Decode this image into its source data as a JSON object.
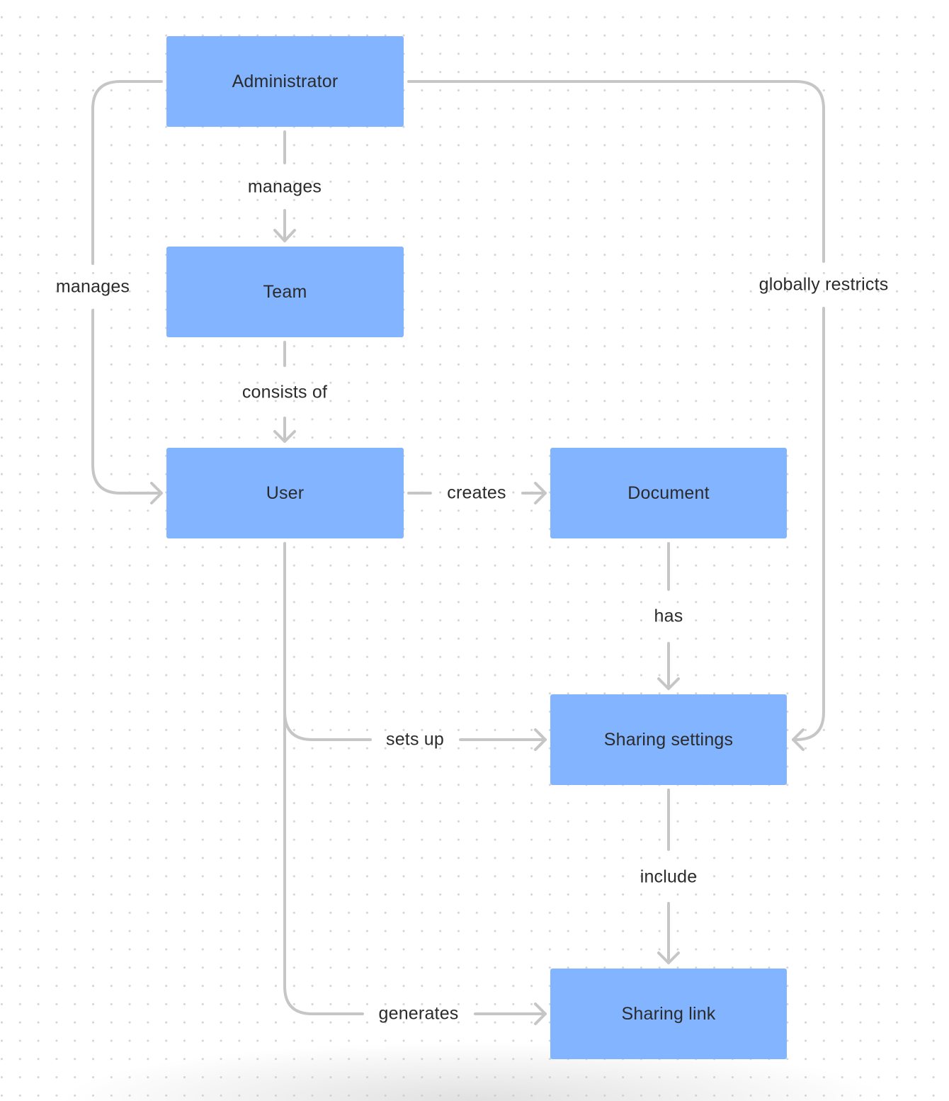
{
  "diagram": {
    "type": "entity-relationship flow",
    "colors": {
      "node_fill": "#82b4ff",
      "edge_stroke": "#c6c6c6",
      "text": "#2b2b2b",
      "background_dot": "#d4d4d4"
    },
    "nodes": {
      "administrator": {
        "label": "Administrator"
      },
      "team": {
        "label": "Team"
      },
      "user": {
        "label": "User"
      },
      "document": {
        "label": "Document"
      },
      "sharing_settings": {
        "label": "Sharing settings"
      },
      "sharing_link": {
        "label": "Sharing link"
      }
    },
    "edges": {
      "admin_team": {
        "from": "Administrator",
        "to": "Team",
        "label": "manages"
      },
      "admin_user": {
        "from": "Administrator",
        "to": "User",
        "label": "manages"
      },
      "admin_settings": {
        "from": "Administrator",
        "to": "Sharing settings",
        "label": "globally restricts"
      },
      "team_user": {
        "from": "Team",
        "to": "User",
        "label": "consists of"
      },
      "user_document": {
        "from": "User",
        "to": "Document",
        "label": "creates"
      },
      "document_settings": {
        "from": "Document",
        "to": "Sharing settings",
        "label": "has"
      },
      "user_settings": {
        "from": "User",
        "to": "Sharing settings",
        "label": "sets up"
      },
      "settings_link": {
        "from": "Sharing settings",
        "to": "Sharing link",
        "label": "include"
      },
      "user_link": {
        "from": "User",
        "to": "Sharing link",
        "label": "generates"
      }
    }
  }
}
